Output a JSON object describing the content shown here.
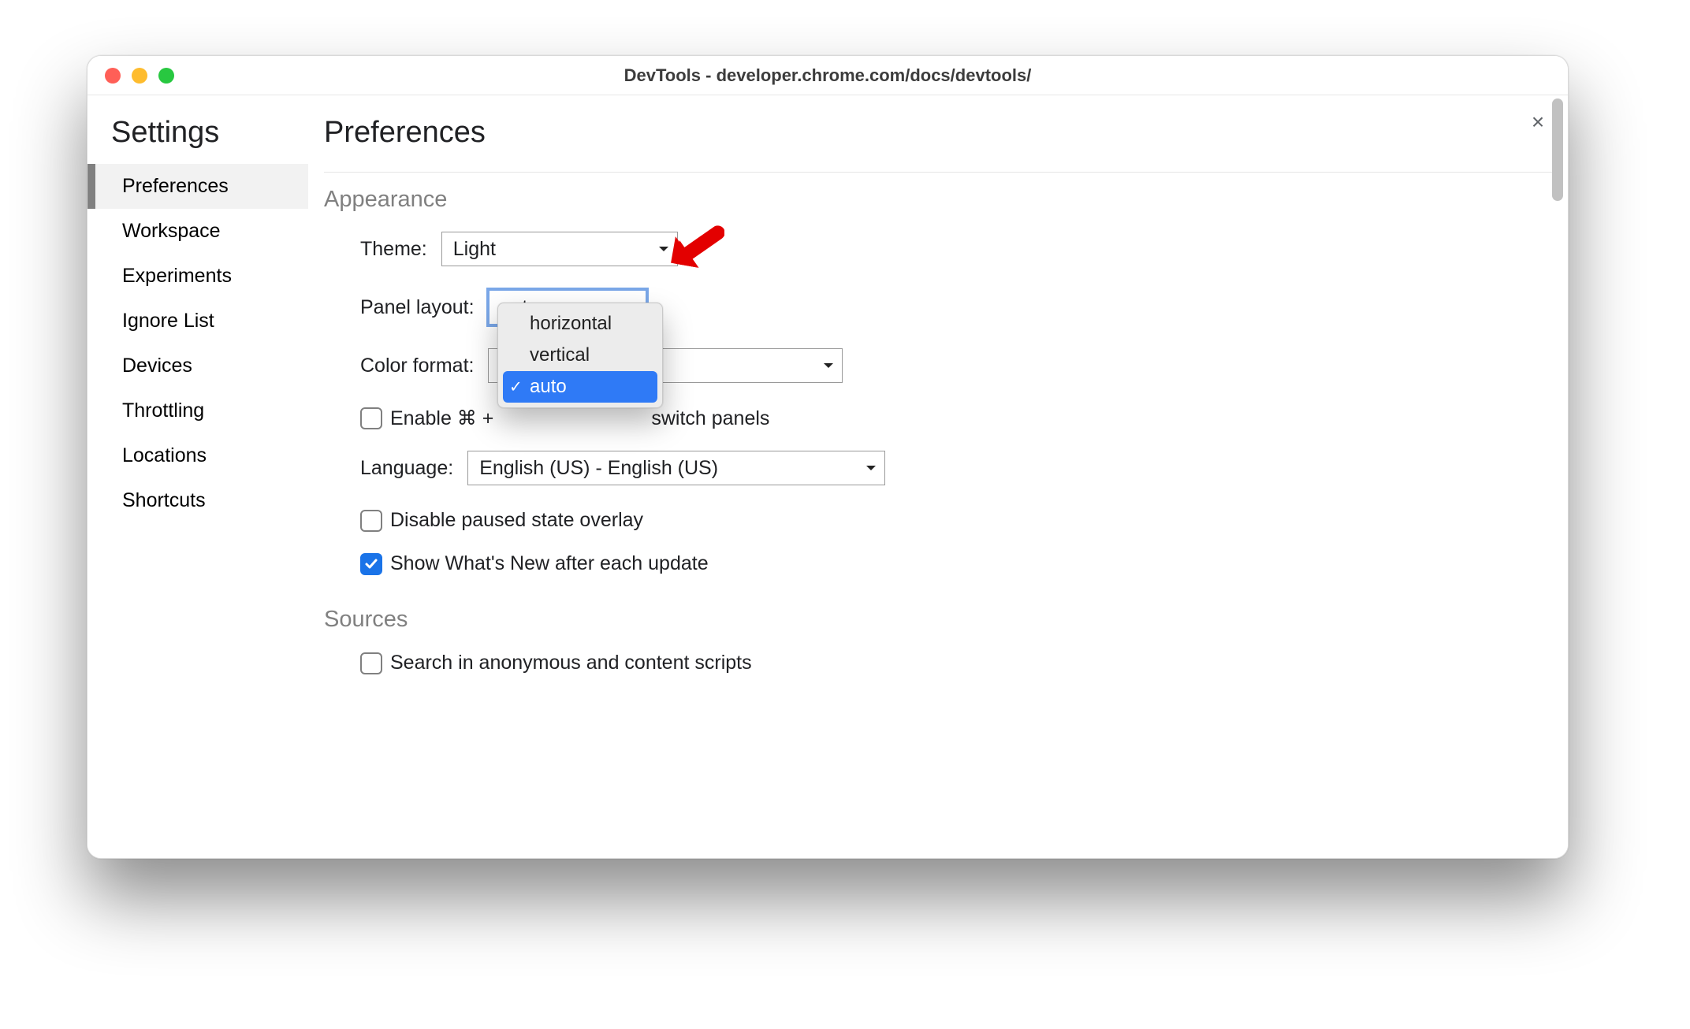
{
  "window": {
    "title": "DevTools - developer.chrome.com/docs/devtools/"
  },
  "close_icon": "×",
  "settings_title": "Settings",
  "sidebar": {
    "items": [
      {
        "label": "Preferences",
        "selected": true
      },
      {
        "label": "Workspace",
        "selected": false
      },
      {
        "label": "Experiments",
        "selected": false
      },
      {
        "label": "Ignore List",
        "selected": false
      },
      {
        "label": "Devices",
        "selected": false
      },
      {
        "label": "Throttling",
        "selected": false
      },
      {
        "label": "Locations",
        "selected": false
      },
      {
        "label": "Shortcuts",
        "selected": false
      }
    ]
  },
  "main": {
    "title": "Preferences",
    "appearance": {
      "heading": "Appearance",
      "theme_label": "Theme:",
      "theme_value": "Light",
      "panel_layout_label": "Panel layout:",
      "panel_layout_value": "auto",
      "panel_layout_options": [
        {
          "label": "horizontal",
          "selected": false
        },
        {
          "label": "vertical",
          "selected": false
        },
        {
          "label": "auto",
          "selected": true
        }
      ],
      "color_format_label": "Color format:",
      "enable_shortcut_prefix": "Enable ⌘ + ",
      "enable_shortcut_suffix": " switch panels",
      "enable_shortcut_checked": false,
      "language_label": "Language:",
      "language_value": "English (US) - English (US)",
      "disable_paused_label": "Disable paused state overlay",
      "disable_paused_checked": false,
      "show_whats_new_label": "Show What's New after each update",
      "show_whats_new_checked": true
    },
    "sources": {
      "heading": "Sources",
      "search_anon_label": "Search in anonymous and content scripts",
      "search_anon_checked": false
    }
  },
  "colors": {
    "accent_blue": "#1a73e8",
    "dropdown_highlight": "#2f7af6",
    "annotation_red": "#e30000"
  }
}
